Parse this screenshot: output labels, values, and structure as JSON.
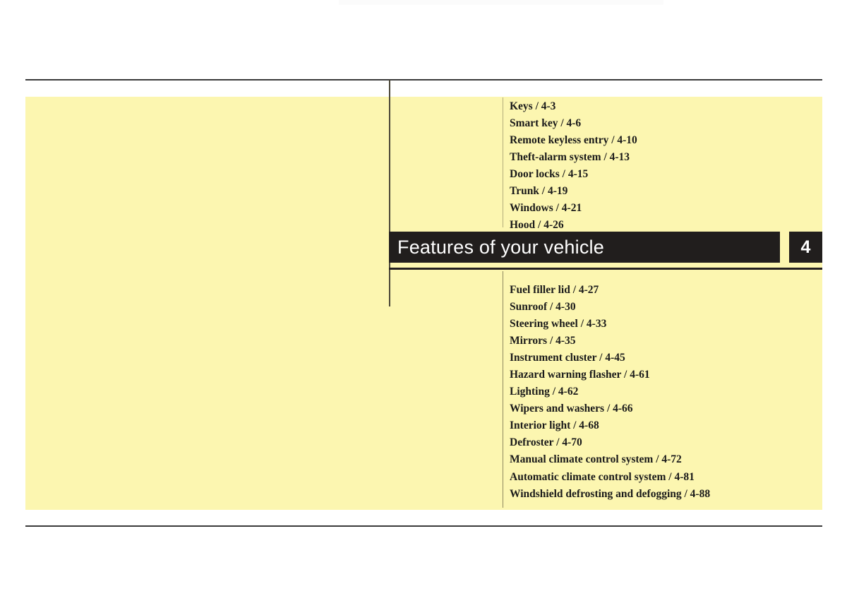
{
  "page": {
    "background_color": "#ffffff",
    "panel_color": "#fcf6b0",
    "accent_dark": "#211e1d",
    "rule_color": "#3a3a3a"
  },
  "chapter": {
    "title": "Features of your vehicle",
    "number": "4"
  },
  "toc": {
    "top_entries": [
      {
        "label": "Keys / 4-3"
      },
      {
        "label": "Smart key / 4-6"
      },
      {
        "label": "Remote keyless entry / 4-10"
      },
      {
        "label": "Theft-alarm system / 4-13"
      },
      {
        "label": "Door locks / 4-15"
      },
      {
        "label": "Trunk / 4-19"
      },
      {
        "label": "Windows / 4-21"
      },
      {
        "label": "Hood / 4-26"
      }
    ],
    "bottom_entries": [
      {
        "label": "Fuel filler lid / 4-27"
      },
      {
        "label": "Sunroof / 4-30"
      },
      {
        "label": "Steering wheel / 4-33"
      },
      {
        "label": "Mirrors / 4-35"
      },
      {
        "label": "Instrument cluster / 4-45"
      },
      {
        "label": "Hazard warning flasher / 4-61"
      },
      {
        "label": "Lighting / 4-62"
      },
      {
        "label": "Wipers and washers / 4-66"
      },
      {
        "label": "Interior light / 4-68"
      },
      {
        "label": "Defroster / 4-70"
      },
      {
        "label": "Manual climate control system / 4-72"
      },
      {
        "label": "Automatic climate control system / 4-81"
      },
      {
        "label": "Windshield defrosting and defogging / 4-88"
      }
    ]
  }
}
